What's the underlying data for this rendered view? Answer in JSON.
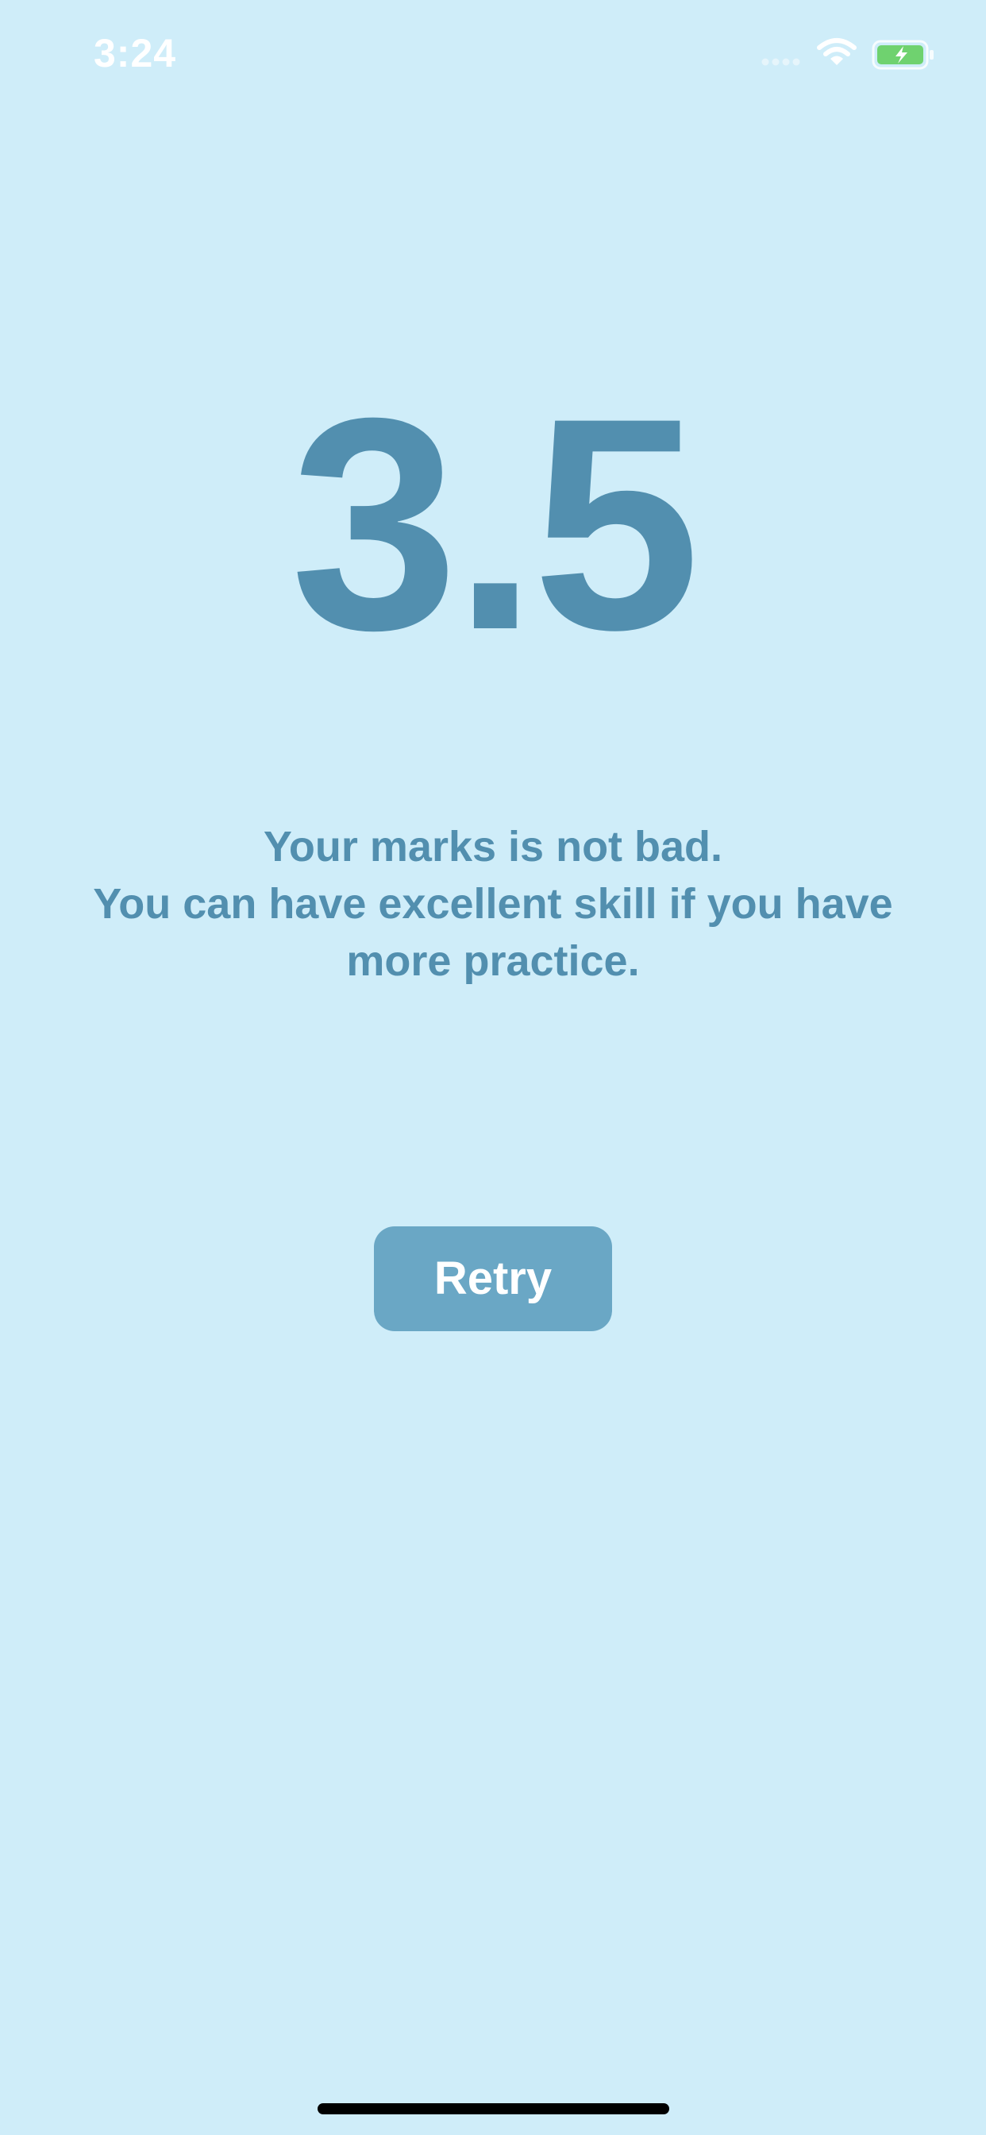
{
  "status_bar": {
    "time": "3:24",
    "icons": [
      "signal-icon",
      "wifi-icon",
      "battery-charging-icon"
    ]
  },
  "result": {
    "score": "3.5",
    "message_lines": [
      "Your marks is not bad.",
      "You can have excellent skill if you have",
      "more practice."
    ]
  },
  "actions": {
    "retry_label": "Retry"
  },
  "colors": {
    "background": "#cfedf9",
    "accent_text": "#528faf",
    "button": "#6aa7c5",
    "button_text": "#ffffff",
    "battery_fill": "#6fd26f"
  }
}
